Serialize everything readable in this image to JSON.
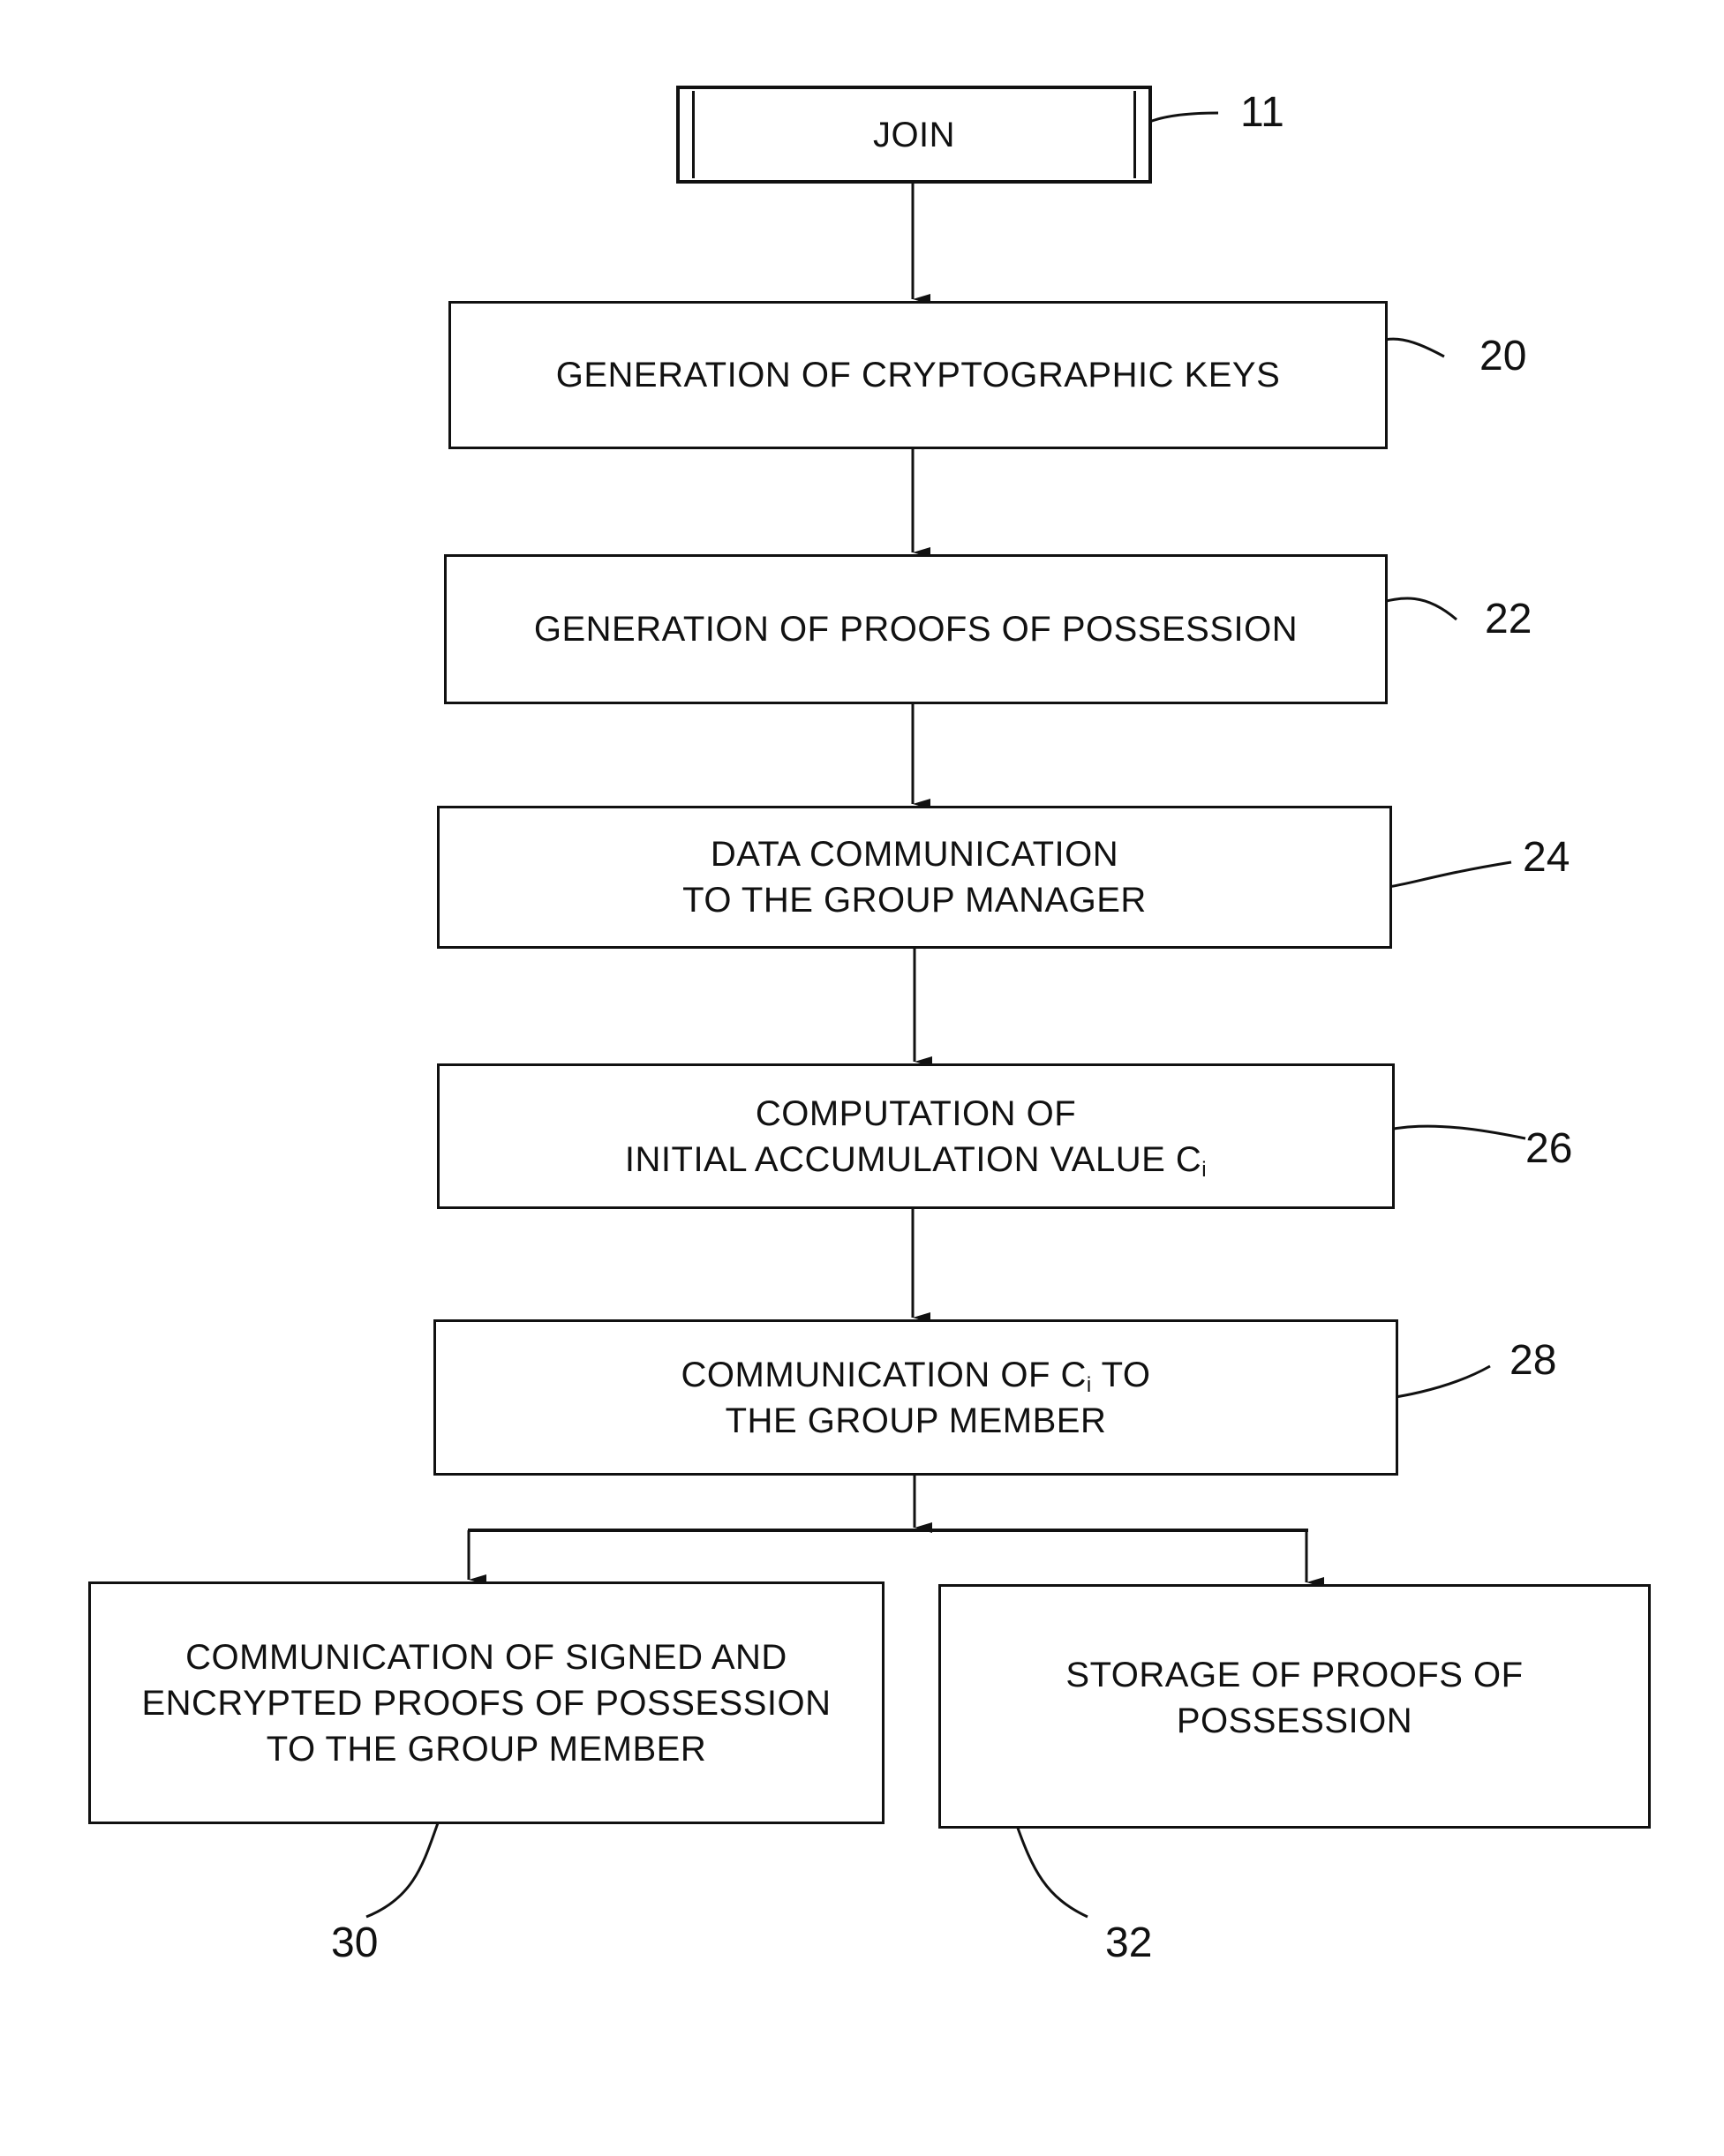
{
  "diagram": {
    "type": "flowchart",
    "nodes": [
      {
        "id": "11",
        "ref": "11",
        "lines": [
          "JOIN"
        ]
      },
      {
        "id": "20",
        "ref": "20",
        "lines": [
          "GENERATION OF CRYPTOGRAPHIC KEYS"
        ]
      },
      {
        "id": "22",
        "ref": "22",
        "lines": [
          "GENERATION OF PROOFS OF POSSESSION"
        ]
      },
      {
        "id": "24",
        "ref": "24",
        "lines": [
          "DATA COMMUNICATION",
          "TO THE GROUP MANAGER"
        ]
      },
      {
        "id": "26",
        "ref": "26",
        "lines": [
          "COMPUTATION OF",
          "INITIAL ACCUMULATION VALUE C"
        ],
        "subscript": "i"
      },
      {
        "id": "28",
        "ref": "28",
        "line1_pre": "COMMUNICATION OF C",
        "line1_sub": "i",
        "line1_post": " TO",
        "line2": "THE GROUP MEMBER"
      },
      {
        "id": "30",
        "ref": "30",
        "lines": [
          "COMMUNICATION OF SIGNED AND",
          "ENCRYPTED PROOFS OF POSSESSION",
          "TO THE GROUP MEMBER"
        ]
      },
      {
        "id": "32",
        "ref": "32",
        "lines": [
          "STORAGE OF PROOFS OF",
          "POSSESSION"
        ]
      }
    ],
    "edges": [
      {
        "from": "11",
        "to": "20"
      },
      {
        "from": "20",
        "to": "22"
      },
      {
        "from": "22",
        "to": "24"
      },
      {
        "from": "24",
        "to": "26"
      },
      {
        "from": "26",
        "to": "28"
      },
      {
        "from": "28",
        "to": "30"
      },
      {
        "from": "28",
        "to": "32"
      }
    ]
  }
}
